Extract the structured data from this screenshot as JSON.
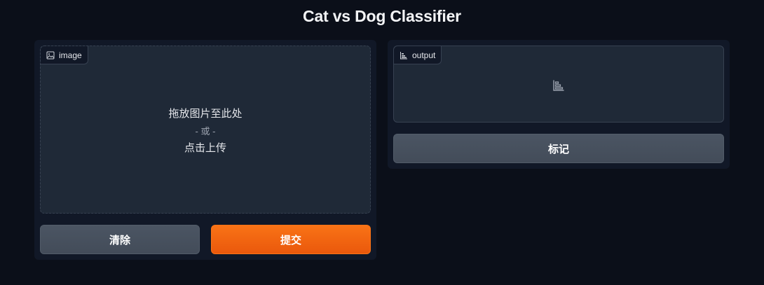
{
  "page": {
    "title": "Cat vs Dog Classifier"
  },
  "input_panel": {
    "label": "image",
    "label_icon": "image-icon",
    "drop_line1": "拖放图片至此处",
    "drop_or": "- 或 -",
    "drop_line2": "点击上传",
    "clear_label": "清除",
    "submit_label": "提交"
  },
  "output_panel": {
    "label": "output",
    "label_icon": "bar-chart-icon",
    "placeholder_icon": "bar-chart-icon",
    "flag_label": "标记"
  },
  "colors": {
    "background": "#0b0f19",
    "panel": "#111827",
    "block": "#1f2937",
    "primary": "#f97316",
    "secondary": "#4b5563"
  }
}
